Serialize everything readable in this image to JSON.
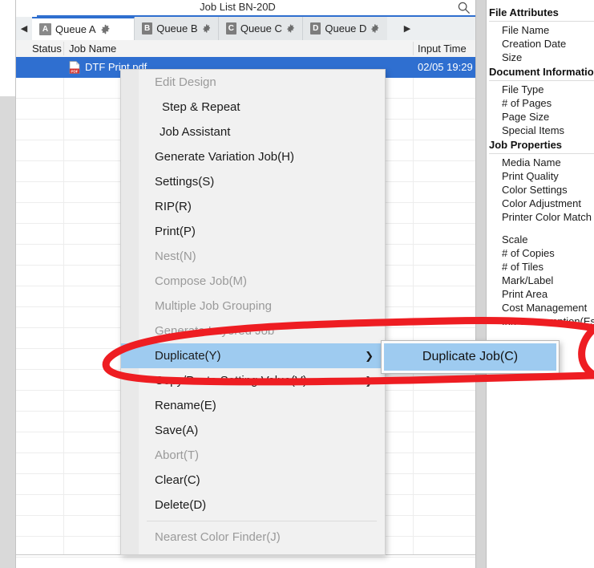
{
  "window": {
    "title": "Job List BN-20D",
    "search_icon": "search-icon"
  },
  "tabs": {
    "scroll_left_icon": "chevron-left-icon",
    "scroll_right_icon": "chevron-right-icon",
    "items": [
      {
        "badge": "A",
        "label": "Queue A",
        "gear_icon": "gear-icon",
        "active": true
      },
      {
        "badge": "B",
        "label": "Queue B",
        "gear_icon": "gear-icon",
        "active": false
      },
      {
        "badge": "C",
        "label": "Queue C",
        "gear_icon": "gear-icon",
        "active": false
      },
      {
        "badge": "D",
        "label": "Queue D",
        "gear_icon": "gear-icon",
        "active": false
      }
    ]
  },
  "joblist": {
    "columns": [
      {
        "key": "status",
        "label": "Status"
      },
      {
        "key": "jobname",
        "label": "Job Name"
      },
      {
        "key": "inputtime",
        "label": "Input Time"
      }
    ],
    "rows": [
      {
        "status": "",
        "file_icon": "pdf-file-icon",
        "jobname": "DTF Print.pdf",
        "inputtime": "02/05 19:29",
        "selected": true
      }
    ]
  },
  "context_menu": {
    "items": [
      {
        "label": "Edit Design",
        "disabled": true,
        "indent": 0,
        "submenu": false,
        "highlight": false
      },
      {
        "label": "Step & Repeat",
        "disabled": false,
        "indent": 1,
        "submenu": false,
        "highlight": false
      },
      {
        "label": "Job Assistant",
        "disabled": false,
        "indent": 2,
        "submenu": false,
        "highlight": false
      },
      {
        "label": "Generate Variation Job(H)",
        "disabled": false,
        "indent": 0,
        "submenu": false,
        "highlight": false
      },
      {
        "label": "Settings(S)",
        "disabled": false,
        "indent": 0,
        "submenu": false,
        "highlight": false
      },
      {
        "label": "RIP(R)",
        "disabled": false,
        "indent": 0,
        "submenu": false,
        "highlight": false
      },
      {
        "label": "Print(P)",
        "disabled": false,
        "indent": 0,
        "submenu": false,
        "highlight": false
      },
      {
        "label": "Nest(N)",
        "disabled": true,
        "indent": 0,
        "submenu": false,
        "highlight": false
      },
      {
        "label": "Compose Job(M)",
        "disabled": true,
        "indent": 0,
        "submenu": false,
        "highlight": false
      },
      {
        "label": "Multiple Job Grouping",
        "disabled": true,
        "indent": 0,
        "submenu": false,
        "highlight": false
      },
      {
        "label": "Generate Layered Job",
        "disabled": true,
        "indent": 0,
        "submenu": false,
        "highlight": false
      },
      {
        "label": "Duplicate(Y)",
        "disabled": false,
        "indent": 0,
        "submenu": true,
        "highlight": true
      },
      {
        "label": "Copy/Paste Setting Value(V)",
        "disabled": false,
        "indent": 0,
        "submenu": true,
        "highlight": false
      },
      {
        "label": "Rename(E)",
        "disabled": false,
        "indent": 0,
        "submenu": false,
        "highlight": false
      },
      {
        "label": "Save(A)",
        "disabled": false,
        "indent": 0,
        "submenu": false,
        "highlight": false
      },
      {
        "label": "Abort(T)",
        "disabled": true,
        "indent": 0,
        "submenu": false,
        "highlight": false
      },
      {
        "label": "Clear(C)",
        "disabled": false,
        "indent": 0,
        "submenu": false,
        "highlight": false
      },
      {
        "label": "Delete(D)",
        "disabled": false,
        "indent": 0,
        "submenu": false,
        "highlight": false
      },
      {
        "label": "Nearest Color Finder(J)",
        "disabled": true,
        "indent": 0,
        "submenu": false,
        "highlight": false,
        "separator_before": true
      }
    ],
    "submenu_arrow": "chevron-right-icon"
  },
  "submenu": {
    "items": [
      {
        "label": "Duplicate Job(C)",
        "highlight": true
      }
    ]
  },
  "properties_panel": {
    "sections": [
      {
        "title": "File Attributes",
        "items": [
          "File Name",
          "Creation Date",
          "Size"
        ]
      },
      {
        "title": "Document Information",
        "items": [
          "File Type",
          "# of Pages",
          "Page Size",
          "Special Items"
        ]
      },
      {
        "title": "Job Properties",
        "items": [
          "Media Name",
          "Print Quality",
          "Color Settings",
          "Color Adjustment",
          "Printer Color Match"
        ]
      },
      {
        "title": "",
        "items": [
          "Scale",
          "# of Copies",
          "# of Tiles",
          "Mark/Label",
          "Print Area",
          "Cost Management",
          "Ink Consumption(Est"
        ]
      }
    ]
  },
  "annotation": {
    "color": "#ee1d22",
    "shape": "hand-drawn-ellipse",
    "target": "Duplicate(Y) / Duplicate Job(C)"
  },
  "colors": {
    "selection_blue": "#2f6fd0",
    "menu_highlight": "#9ecbf0",
    "tab_accent": "#2f6fcf",
    "annotation_red": "#ee1d22"
  }
}
